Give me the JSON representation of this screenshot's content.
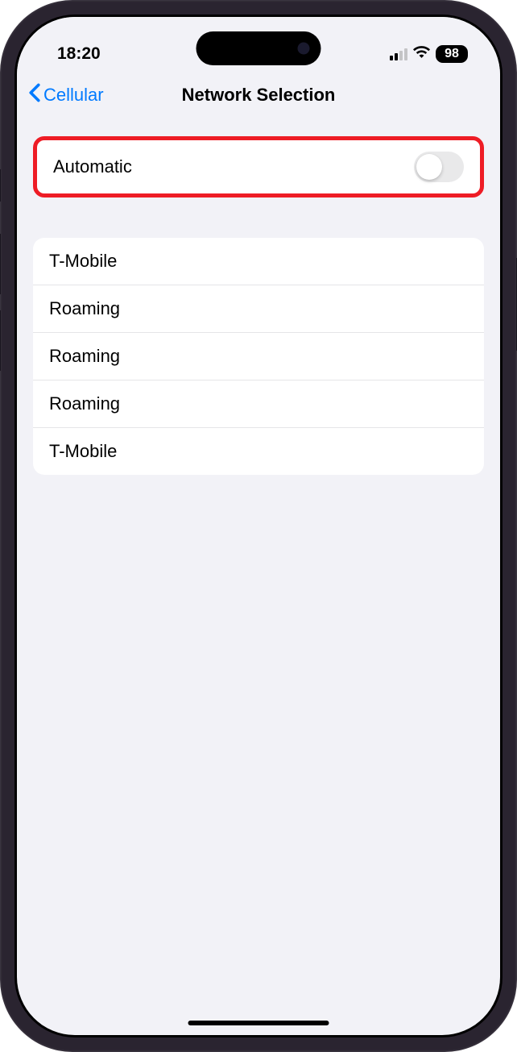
{
  "status_bar": {
    "time": "18:20",
    "battery_percent": "98"
  },
  "nav": {
    "back_label": "Cellular",
    "title": "Network Selection"
  },
  "automatic": {
    "label": "Automatic",
    "enabled": false
  },
  "networks": [
    {
      "name": "T-Mobile"
    },
    {
      "name": "Roaming"
    },
    {
      "name": "Roaming"
    },
    {
      "name": "Roaming"
    },
    {
      "name": "T-Mobile"
    }
  ]
}
